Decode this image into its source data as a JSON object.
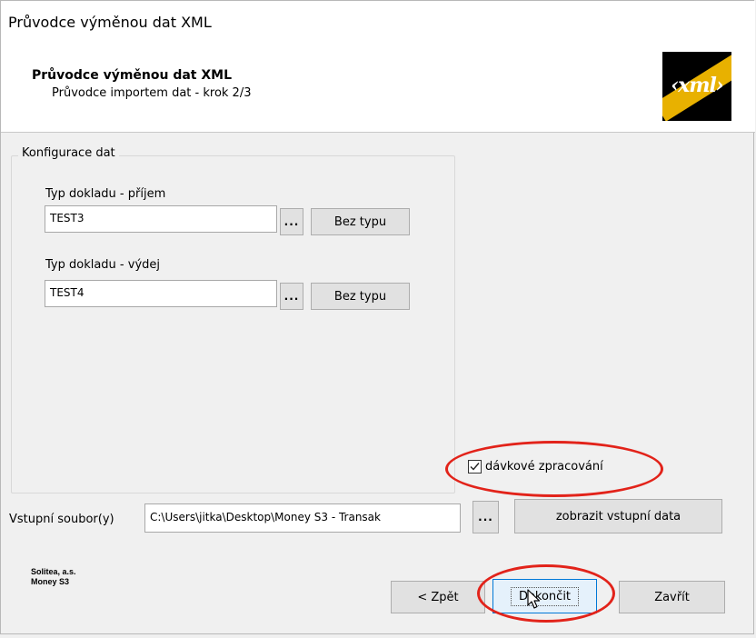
{
  "window": {
    "title": "Průvodce výměnou dat XML"
  },
  "header": {
    "title": "Průvodce výměnou dat XML",
    "subtitle": "Průvodce importem dat - krok 2/3",
    "logo_text": "xml"
  },
  "config": {
    "group_label": "Konfigurace dat",
    "receipt_label": "Typ dokladu - příjem",
    "receipt_value": "TEST3",
    "issue_label": "Typ dokladu - výdej",
    "issue_value": "TEST4",
    "browse_label": "...",
    "no_type_label": "Bez typu"
  },
  "batch": {
    "label": "dávkové zpracování",
    "checked": true
  },
  "input_file": {
    "label": "Vstupní soubor(y)",
    "value": "C:\\Users\\jitka\\Desktop\\Money S3 - Transak",
    "browse_label": "...",
    "show_data_label": "zobrazit vstupní data"
  },
  "footer": {
    "company": "Solitea, a.s.",
    "product": "Money S3"
  },
  "buttons": {
    "back": "< Zpět",
    "finish": "Dokončit",
    "close": "Zavřít"
  },
  "colors": {
    "annotation": "#e2231a",
    "logo_accent": "#e8b100"
  }
}
